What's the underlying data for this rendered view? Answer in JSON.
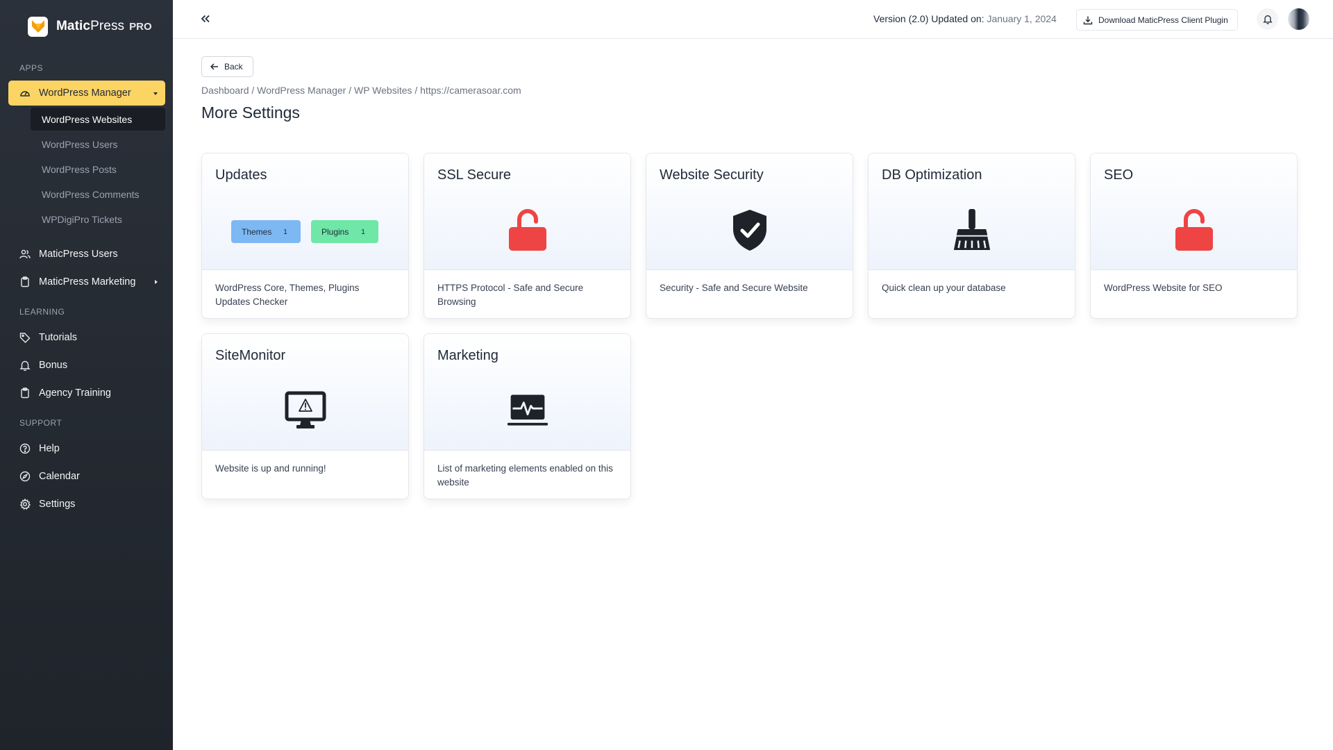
{
  "brand": {
    "name_bold": "Matic",
    "name_light": "Press",
    "pro": "PRO"
  },
  "sidebar": {
    "apps_label": "APPS",
    "wordpress_manager": "WordPress Manager",
    "sub_items": [
      "WordPress Websites",
      "WordPress Users",
      "WordPress Posts",
      "WordPress Comments",
      "WPDigiPro Tickets"
    ],
    "maticpress_users": "MaticPress Users",
    "maticpress_marketing": "MaticPress Marketing",
    "learning_label": "LEARNING",
    "tutorials": "Tutorials",
    "bonus": "Bonus",
    "agency_training": "Agency Training",
    "support_label": "SUPPORT",
    "help": "Help",
    "calendar": "Calendar",
    "settings": "Settings"
  },
  "topbar": {
    "version_text": "Version (2.0) Updated on:",
    "version_date": "January 1, 2024",
    "download_label": "Download MaticPress Client Plugin"
  },
  "main": {
    "back_label": "Back",
    "breadcrumb": [
      "Dashboard",
      "WordPress Manager",
      "WP Websites",
      "https://camerasoar.com"
    ],
    "breadcrumb_sep": "/",
    "title": "More Settings"
  },
  "cards": {
    "updates": {
      "title": "Updates",
      "desc": "WordPress Core, Themes, Plugins Updates Checker",
      "themes_label": "Themes",
      "themes_count": "1",
      "plugins_label": "Plugins",
      "plugins_count": "1"
    },
    "ssl": {
      "title": "SSL Secure",
      "desc": "HTTPS Protocol - Safe and Secure Browsing"
    },
    "security": {
      "title": "Website Security",
      "desc": "Security - Safe and Secure Website"
    },
    "db": {
      "title": "DB Optimization",
      "desc": "Quick clean up your database"
    },
    "seo": {
      "title": "SEO",
      "desc": "WordPress Website for SEO"
    },
    "sitemonitor": {
      "title": "SiteMonitor",
      "desc": "Website is up and running!"
    },
    "marketing": {
      "title": "Marketing",
      "desc": "List of marketing elements enabled on this website"
    }
  },
  "colors": {
    "accent": "#fcd463",
    "sidebar_bg": "#252a31",
    "lock_red": "#ef4444",
    "themes_pill": "#7db8f3",
    "plugins_pill": "#6ee7a7"
  }
}
